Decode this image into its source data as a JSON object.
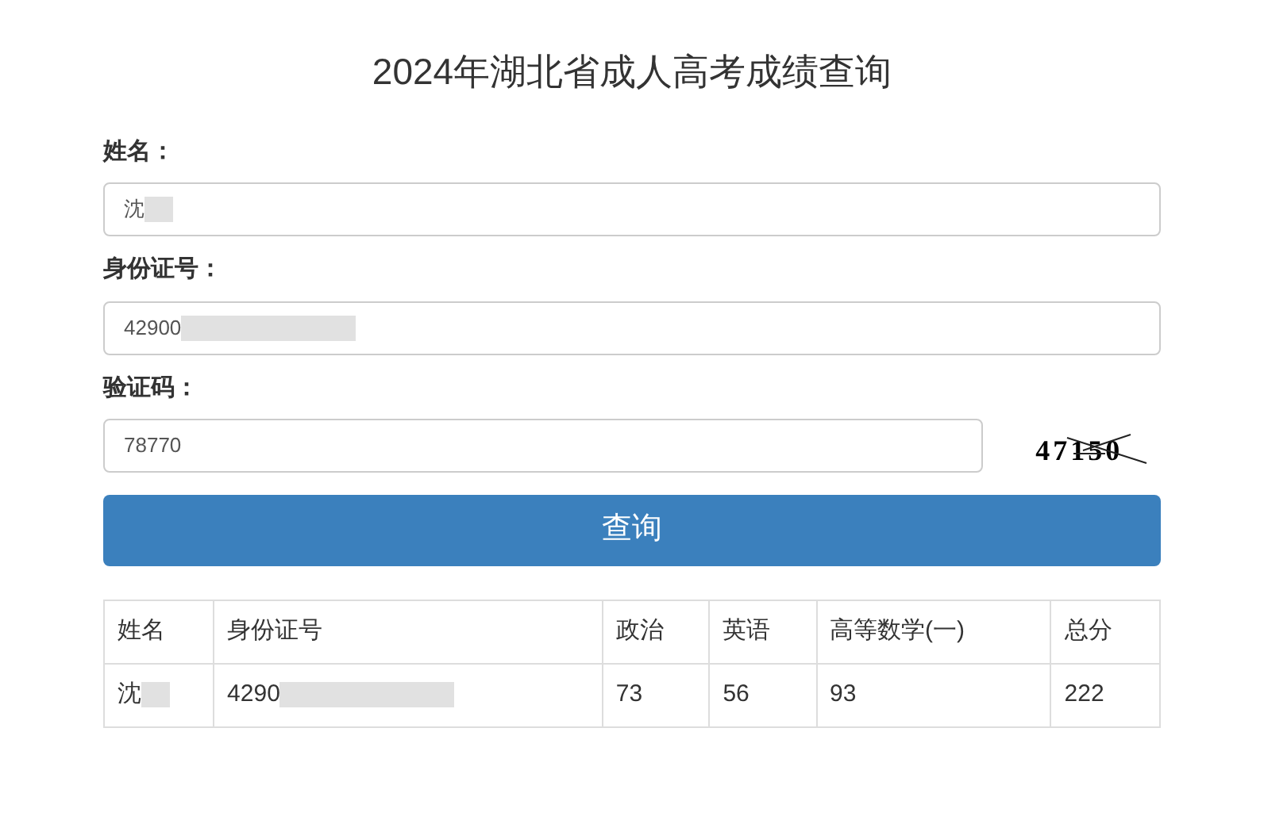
{
  "title": "2024年湖北省成人高考成绩查询",
  "fields": [
    {
      "label": "姓名：",
      "value": "沈",
      "redacted": true
    },
    {
      "label": "身份证号：",
      "value": "42900",
      "redacted": true
    }
  ],
  "captcha": {
    "label": "验证码：",
    "value": "78770",
    "image_text": "47150"
  },
  "submit": "查询",
  "table": {
    "columns": [
      "姓名",
      "身份证号",
      "政治",
      "英语",
      "高等数学(一)",
      "总分"
    ],
    "rows": [
      {
        "cells": [
          {
            "text": "沈",
            "redacted": true
          },
          {
            "text": "4290",
            "redacted": true
          },
          {
            "text": "73",
            "redacted": false
          },
          {
            "text": "56",
            "redacted": false
          },
          {
            "text": "93",
            "redacted": false
          },
          {
            "text": "222",
            "redacted": false
          }
        ]
      }
    ]
  }
}
